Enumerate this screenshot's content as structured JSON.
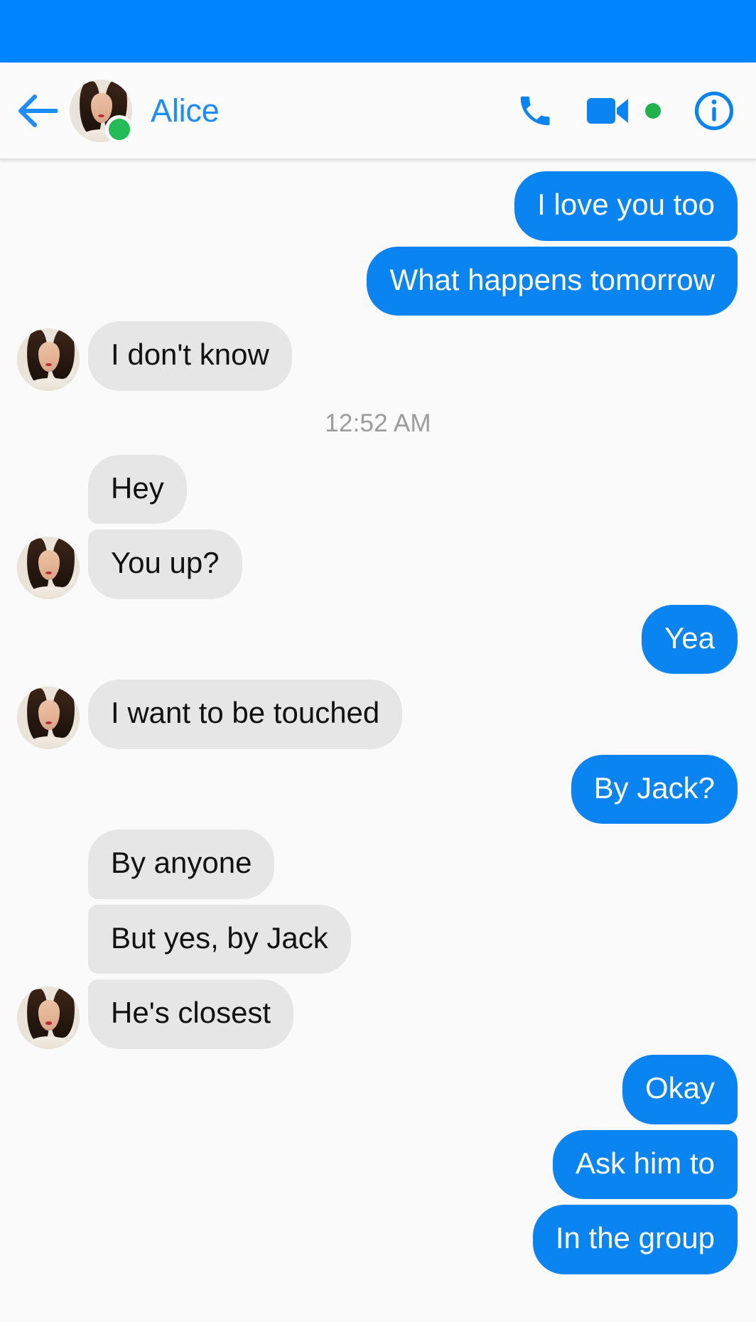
{
  "app": {
    "status_bar_color": "#0084ff",
    "background_color": "#fafafa"
  },
  "header": {
    "back_icon": "back-arrow-icon",
    "contact_name": "Alice",
    "contact_name_color": "#1c8cf8",
    "avatar_alt": "Alice profile photo",
    "online_status": "online",
    "online_dot_color": "#22bb55",
    "actions": [
      {
        "name": "voice-call-button",
        "icon": "phone-icon",
        "color": "#0a84f0"
      },
      {
        "name": "video-call-button",
        "icon": "video-camera-icon",
        "color": "#0a84f0"
      },
      {
        "name": "video-available-indicator",
        "icon": "green-dot-icon",
        "color": "#22b14c"
      },
      {
        "name": "conversation-info-button",
        "icon": "info-circle-icon",
        "color": "#0a84f0"
      }
    ]
  },
  "conversation": {
    "bubble_colors": {
      "outgoing": "#0a84f0",
      "outgoing_text": "#ffffff",
      "incoming": "#e6e6e6",
      "incoming_text": "#111111"
    },
    "items": [
      {
        "kind": "message",
        "side": "out",
        "text": "I love you too",
        "group": "top",
        "avatar": false
      },
      {
        "kind": "message",
        "side": "out",
        "text": "What happens tomorrow",
        "group": "bottom",
        "avatar": false
      },
      {
        "kind": "message",
        "side": "in",
        "text": "I don't know",
        "group": "single",
        "avatar": true
      },
      {
        "kind": "time",
        "text": "12:52 AM"
      },
      {
        "kind": "message",
        "side": "in",
        "text": "Hey",
        "group": "top",
        "avatar": false
      },
      {
        "kind": "message",
        "side": "in",
        "text": "You up?",
        "group": "bottom",
        "avatar": true
      },
      {
        "kind": "message",
        "side": "out",
        "text": "Yea",
        "group": "single",
        "avatar": false
      },
      {
        "kind": "message",
        "side": "in",
        "text": "I want to be touched",
        "group": "single",
        "avatar": true
      },
      {
        "kind": "message",
        "side": "out",
        "text": "By Jack?",
        "group": "single",
        "avatar": false
      },
      {
        "kind": "message",
        "side": "in",
        "text": "By anyone",
        "group": "top",
        "avatar": false
      },
      {
        "kind": "message",
        "side": "in",
        "text": "But yes, by Jack",
        "group": "mid",
        "avatar": false
      },
      {
        "kind": "message",
        "side": "in",
        "text": "He's closest",
        "group": "bottom",
        "avatar": true
      },
      {
        "kind": "message",
        "side": "out",
        "text": "Okay",
        "group": "top",
        "avatar": false
      },
      {
        "kind": "message",
        "side": "out",
        "text": "Ask him to",
        "group": "mid",
        "avatar": false
      },
      {
        "kind": "message",
        "side": "out",
        "text": "In the group",
        "group": "bottom",
        "avatar": false
      }
    ]
  }
}
